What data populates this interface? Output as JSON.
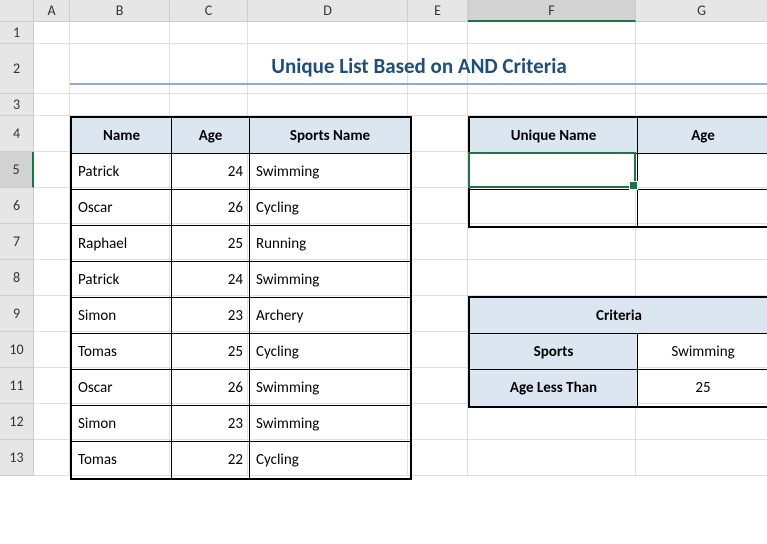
{
  "columns": [
    "A",
    "B",
    "C",
    "D",
    "E",
    "F",
    "G"
  ],
  "rows": [
    "1",
    "2",
    "3",
    "4",
    "5",
    "6",
    "7",
    "8",
    "9",
    "10",
    "11",
    "12",
    "13"
  ],
  "active": {
    "col": "F",
    "row": "5"
  },
  "title": "Unique List Based on AND Criteria",
  "mainTable": {
    "headers": [
      "Name",
      "Age",
      "Sports Name"
    ],
    "rows": [
      {
        "name": "Patrick",
        "age": "24",
        "sport": "Swimming"
      },
      {
        "name": "Oscar",
        "age": "26",
        "sport": "Cycling"
      },
      {
        "name": "Raphael",
        "age": "25",
        "sport": "Running"
      },
      {
        "name": "Patrick",
        "age": "24",
        "sport": "Swimming"
      },
      {
        "name": "Simon",
        "age": "23",
        "sport": "Archery"
      },
      {
        "name": "Tomas",
        "age": "25",
        "sport": "Cycling"
      },
      {
        "name": "Oscar",
        "age": "26",
        "sport": "Swimming"
      },
      {
        "name": "Simon",
        "age": "23",
        "sport": "Swimming"
      },
      {
        "name": "Tomas",
        "age": "22",
        "sport": "Cycling"
      }
    ]
  },
  "uniqTable": {
    "headers": [
      "Unique Name",
      "Age"
    ],
    "rows": [
      {
        "name": "",
        "age": ""
      },
      {
        "name": "",
        "age": ""
      }
    ]
  },
  "critTable": {
    "title": "Criteria",
    "rows": [
      {
        "label": "Sports",
        "value": "Swimming"
      },
      {
        "label": "Age Less Than",
        "value": "25"
      }
    ]
  }
}
